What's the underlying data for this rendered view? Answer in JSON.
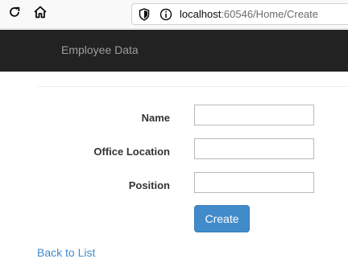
{
  "browser": {
    "url_host": "localhost",
    "url_rest": ":60546/Home/Create"
  },
  "navbar": {
    "brand": "Employee Data"
  },
  "form": {
    "fields": [
      {
        "label": "Name",
        "value": ""
      },
      {
        "label": "Office Location",
        "value": ""
      },
      {
        "label": "Position",
        "value": ""
      }
    ],
    "submit_label": "Create"
  },
  "footer": {
    "back_link": "Back to List"
  },
  "colors": {
    "navbar_bg": "#222222",
    "primary": "#428bca",
    "link": "#428bca"
  },
  "icons": [
    "reload-icon",
    "home-icon",
    "shield-icon",
    "info-icon"
  ]
}
